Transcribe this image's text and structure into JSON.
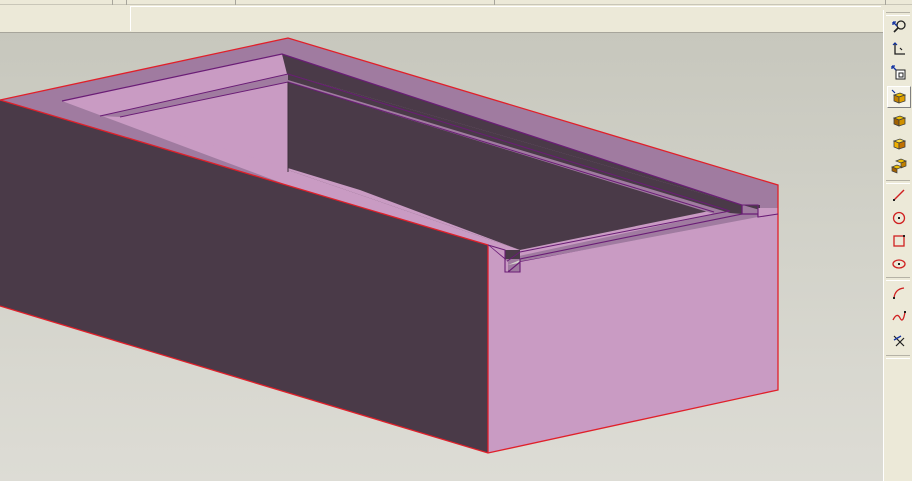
{
  "window": {
    "background": "#d4d0c8"
  },
  "viewport": {
    "model": "open-box-with-ledge",
    "colors": {
      "face_light": "#c898c0",
      "face_dark": "#4a3a48",
      "face_top": "#a07ba0",
      "edge": "#e0202a",
      "inner_edge": "#6a1d76"
    }
  },
  "toolbar": {
    "tools": [
      {
        "icon": "zoom-view-icon",
        "active": false
      },
      {
        "icon": "axis-corner-icon",
        "active": false
      },
      {
        "icon": "zoom-window-icon",
        "active": false
      },
      {
        "icon": "shaded-cube-icon",
        "active": true
      },
      {
        "icon": "hidden-line-cube-icon",
        "active": false
      },
      {
        "icon": "wireframe-cube-icon",
        "active": false
      },
      {
        "icon": "multi-cube-icon",
        "active": false
      },
      {
        "icon": "line-tool-icon",
        "active": false
      },
      {
        "icon": "circle-tool-icon",
        "active": false
      },
      {
        "icon": "rectangle-tool-icon",
        "active": false
      },
      {
        "icon": "ellipse-tool-icon",
        "active": false
      },
      {
        "icon": "arc-tool-icon",
        "active": false
      },
      {
        "icon": "spline-tool-icon",
        "active": false
      },
      {
        "icon": "trim-tool-icon",
        "active": false
      }
    ]
  }
}
